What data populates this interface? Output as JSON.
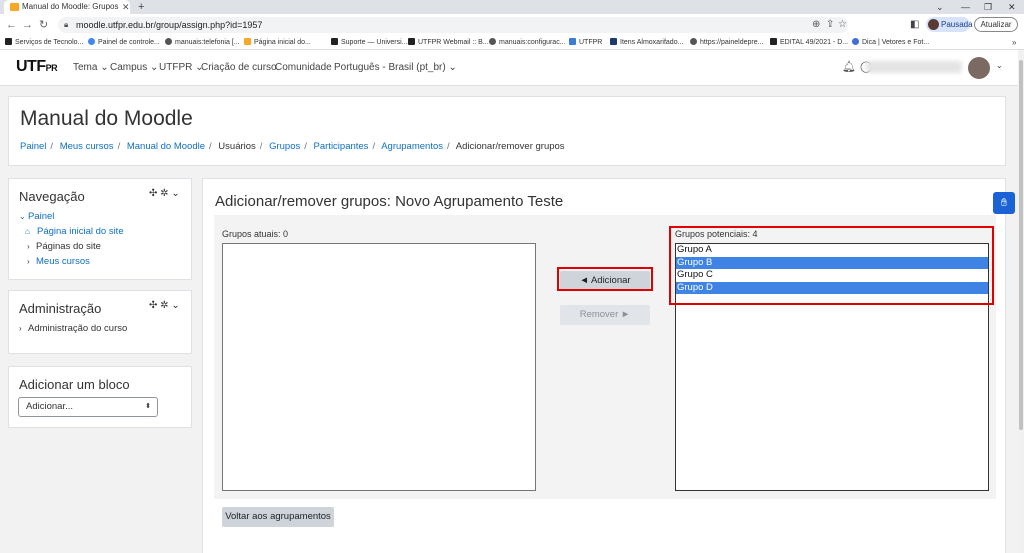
{
  "browser": {
    "tab_title": "Manual do Moodle: Grupos",
    "tab_close": "✕",
    "new_tab": "+",
    "win_minimize": "⌄",
    "win_min": "—",
    "win_restore": "❐",
    "win_close": "✕",
    "url": "moodle.utfpr.edu.br/group/assign.php?id=1957",
    "profile_label": "Pausada",
    "update_label": "Atualizar",
    "bookmarks": [
      "Serviços de Tecnolo...",
      "Painel de controle...",
      "manuais:telefonia [...",
      "Página inicial do...",
      "Suporte — Universi...",
      "UTFPR Webmail :: B...",
      "manuais:configurac...",
      "UTFPR",
      "Itens Almoxarifado...",
      "https://paineldepre...",
      "EDITAL 49/2021 - D...",
      "Dica | Vetores e Fot..."
    ],
    "bookmarks_more": "»"
  },
  "navbar": {
    "logo_main": "UT",
    "logo_mid": "F",
    "logo_sub": "PR",
    "menu": [
      "Tema ⌄",
      "Campus ⌄",
      "UTFPR ⌄",
      "Criação de curso",
      "Comunidade",
      "Português - Brasil (pt_br) ⌄"
    ],
    "caret": "⌄"
  },
  "header": {
    "course_title": "Manual do Moodle",
    "breadcrumb": [
      "Painel",
      "Meus cursos",
      "Manual do Moodle",
      "Usuários",
      "Grupos",
      "Participantes",
      "Agrupamentos",
      "Adicionar/remover grupos"
    ]
  },
  "navigation_block": {
    "title": "Navegação",
    "controls": "✣ ✲ ⌄",
    "items": [
      {
        "label": "Painel",
        "chevron": "⌄"
      },
      {
        "label": "Página inicial do site",
        "icon": "⌂"
      },
      {
        "label": "Páginas do site",
        "chevron": "›"
      },
      {
        "label": "Meus cursos",
        "chevron": "›"
      }
    ]
  },
  "admin_block": {
    "title": "Administração",
    "controls": "✣ ✲ ⌄",
    "items": [
      {
        "label": "Administração do curso",
        "chevron": "›"
      }
    ]
  },
  "add_block": {
    "title": "Adicionar um bloco",
    "select_value": "Adicionar...",
    "arrow": "⬍"
  },
  "main": {
    "heading": "Adicionar/remover grupos: Novo Agrupamento Teste",
    "current_label": "Grupos atuais: 0",
    "potential_label": "Grupos potenciais: 4",
    "add_button": "◄ Adicionar",
    "remove_button": "Remover ►",
    "back_button": "Voltar aos agrupamentos",
    "current_groups": [],
    "potential_groups": [
      {
        "name": "Grupo A",
        "selected": false
      },
      {
        "name": "Grupo B",
        "selected": true
      },
      {
        "name": "Grupo C",
        "selected": false
      },
      {
        "name": "Grupo D",
        "selected": true
      }
    ]
  },
  "colors": {
    "link": "#0f6fc5",
    "selection": "#3f84e5",
    "highlight": "#e00000"
  }
}
